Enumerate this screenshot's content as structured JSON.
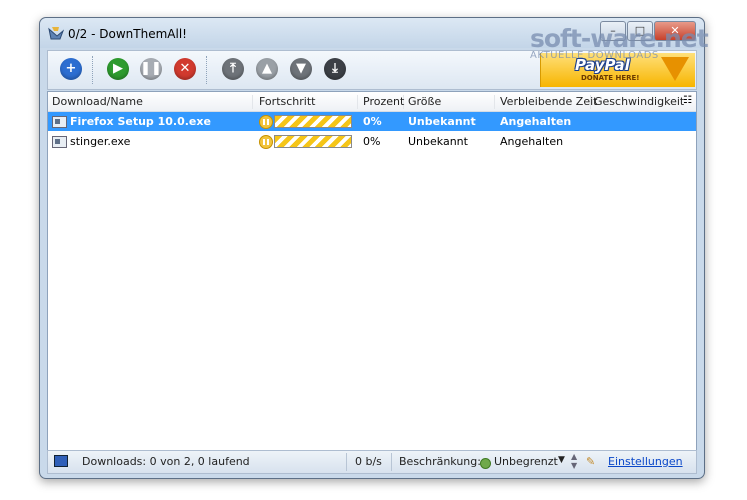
{
  "window": {
    "title": "0/2 - DownThemAll!"
  },
  "toolbar": {
    "buttons": [
      {
        "name": "add-icon",
        "glyph": "+",
        "color": "#2d6ed1"
      },
      {
        "name": "play-icon",
        "glyph": "▶",
        "color": "#2e9b2e"
      },
      {
        "name": "pause-icon",
        "glyph": "❚❚",
        "color": "#a7acb3"
      },
      {
        "name": "cancel-icon",
        "glyph": "✕",
        "color": "#d13a2e"
      },
      {
        "name": "move-top-icon",
        "glyph": "⤒",
        "color": "#6e7379"
      },
      {
        "name": "move-up-icon",
        "glyph": "▲",
        "color": "#9aa0a6"
      },
      {
        "name": "move-down-icon",
        "glyph": "▼",
        "color": "#6e7379"
      },
      {
        "name": "move-bottom-icon",
        "glyph": "⤓",
        "color": "#3c4046"
      }
    ]
  },
  "paypal": {
    "logo": "PayPal",
    "donate": "DONATE HERE!"
  },
  "columns": {
    "name": "Download/Name",
    "progress": "Fortschritt",
    "percent": "Prozent",
    "size": "Größe",
    "remaining": "Verbleibende Zeit",
    "speed": "Geschwindigkeit"
  },
  "downloads": [
    {
      "name": "Firefox Setup 10.0.exe",
      "percent": "0%",
      "progress": 1,
      "size": "Unbekannt",
      "status": "Angehalten"
    },
    {
      "name": "stinger.exe",
      "percent": "0%",
      "progress": 1,
      "size": "Unbekannt",
      "status": "Angehalten"
    }
  ],
  "statusbar": {
    "downloads": "Downloads: 0 von 2, 0 laufend",
    "speed": "0 b/s",
    "limit_label": "Beschränkung:",
    "limit_value": "Unbegrenzt",
    "settings": "Einstellungen"
  },
  "watermark": {
    "main": "soft-ware.net",
    "sub": "AKTUELLE DOWNLOADS"
  },
  "colors": {
    "selection": "#3399ff",
    "progress_stripe": "#f5c518",
    "window_frame": "#c9d9ea"
  }
}
